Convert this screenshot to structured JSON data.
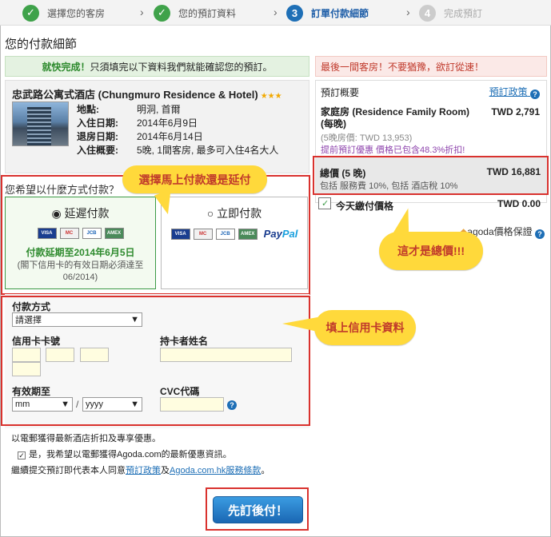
{
  "steps": [
    {
      "num": "✓",
      "label": "選擇您的客房"
    },
    {
      "num": "✓",
      "label": "您的預訂資料"
    },
    {
      "num": "3",
      "label": "訂單付款細節"
    },
    {
      "num": "4",
      "label": "完成預訂"
    }
  ],
  "page_title": "您的付款細節",
  "notice": {
    "bold": "就快完成！",
    "text": "只須填完以下資料我們就能確認您的預訂。"
  },
  "urgency": "最後一間客房！不要猶豫，欲訂從速！",
  "hotel": {
    "name": "忠武路公寓式酒店 (Chungmuro Residence & Hotel)",
    "stars": "★★★",
    "rows": [
      {
        "k": "地點:",
        "v": "明洞, 首爾"
      },
      {
        "k": "入住日期:",
        "v": "2014年6月9日"
      },
      {
        "k": "退房日期:",
        "v": "2014年6月14日"
      },
      {
        "k": "入住概要:",
        "v": "5晚, 1間客房, 最多可入住4名大人"
      }
    ]
  },
  "payment_question": "您希望以什麼方式付款？",
  "options": {
    "defer": {
      "label": "延遲付款",
      "defer_text": "付款延期至2014年6月5日",
      "note": "(閣下信用卡的有效日期必須達至06/2014)"
    },
    "now": {
      "label": "立即付款"
    }
  },
  "cards": {
    "visa": "VISA",
    "mc": "MC",
    "jcb": "JCB",
    "amex": "AMEX",
    "paypal_a": "Pay",
    "paypal_b": "Pal"
  },
  "form": {
    "method_label": "付款方式",
    "method_value": "請選擇",
    "card_no_label": "信用卡卡號",
    "holder_label": "持卡者姓名",
    "expiry_label": "有效期至",
    "mm": "mm",
    "yyyy": "yyyy",
    "slash": "/",
    "cvc_label": "CVC代碼",
    "help": "?"
  },
  "promo": {
    "line1": "以電郵獲得最新酒店折扣及專享優惠。",
    "check_text": "是，我希望以電郵獲得Agoda.com的最新優惠資訊。",
    "terms_prefix": "繼續提交預訂即代表本人同意",
    "terms_link1": "預訂政策",
    "terms_and": "及",
    "terms_link2": "Agoda.com.hk服務條款",
    "terms_suffix": "。"
  },
  "submit": "先訂後付！",
  "summary": {
    "title": "預訂概要",
    "policy": "預訂政策",
    "room": "家庭房 (Residence Family Room) (每晚)",
    "room_price": "TWD   2,791",
    "room_sub": "(5晚房價: TWD 13,953)",
    "discount": "提前預訂優惠 價格已包含48.3%折扣!",
    "total_label": "總價 (5 晚)",
    "total_value": "TWD 16,881",
    "total_note": "包括 服務費 10%, 包括 酒店稅 10%",
    "today_label": "今天繳付價格",
    "today_value": "TWD      0.00",
    "guarantee": "agoda價格保證"
  },
  "annotations": {
    "a1": "選擇馬上付款還是延付",
    "a2": "這才是總價!!!",
    "a3": "填上信用卡資料"
  },
  "colors": {
    "accent": "#1e6fb6",
    "done": "#3fa24a",
    "highlight": "#d9322e",
    "bubble": "#ffd93b"
  }
}
